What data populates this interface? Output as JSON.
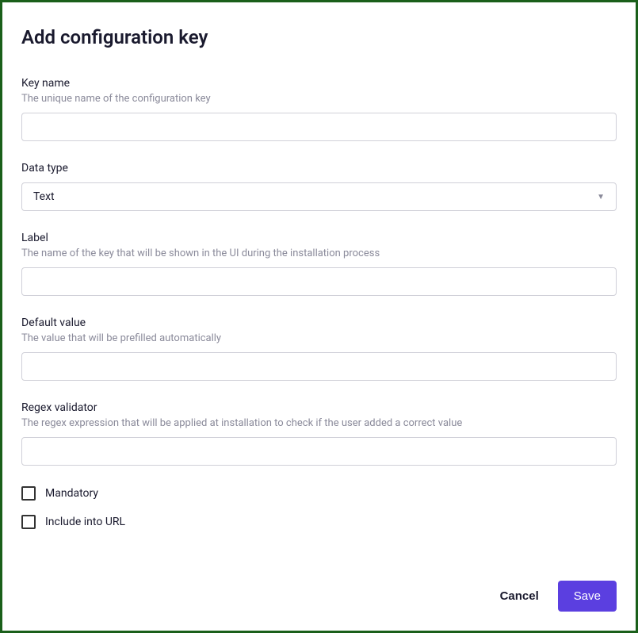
{
  "title": "Add configuration key",
  "fields": {
    "keyName": {
      "label": "Key name",
      "help": "The unique name of the configuration key",
      "value": ""
    },
    "dataType": {
      "label": "Data type",
      "selected": "Text"
    },
    "uiLabel": {
      "label": "Label",
      "help": "The name of the key that will be shown in the UI during the installation process",
      "value": ""
    },
    "defaultValue": {
      "label": "Default value",
      "help": "The value that will be prefilled automatically",
      "value": ""
    },
    "regex": {
      "label": "Regex validator",
      "help": "The regex expression that will be applied at installation to check if the user added a correct value",
      "value": ""
    }
  },
  "checkboxes": {
    "mandatory": {
      "label": "Mandatory",
      "checked": false
    },
    "includeUrl": {
      "label": "Include into URL",
      "checked": false
    }
  },
  "buttons": {
    "cancel": "Cancel",
    "save": "Save"
  }
}
